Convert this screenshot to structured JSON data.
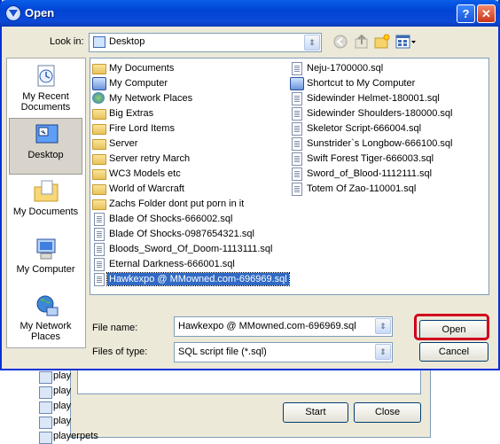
{
  "dialog": {
    "title": "Open",
    "help_label": "?",
    "close_label": "✕",
    "look_in_label": "Look in:",
    "look_in_value": "Desktop"
  },
  "places": [
    {
      "label": "My Recent Documents",
      "name": "place-my-recent-documents",
      "selected": false
    },
    {
      "label": "Desktop",
      "name": "place-desktop",
      "selected": true
    },
    {
      "label": "My Documents",
      "name": "place-my-documents",
      "selected": false
    },
    {
      "label": "My Computer",
      "name": "place-my-computer",
      "selected": false
    },
    {
      "label": "My Network Places",
      "name": "place-my-network-places",
      "selected": false
    }
  ],
  "files_col1": [
    {
      "name": "My Documents",
      "icon": "my-documents-icon"
    },
    {
      "name": "My Computer",
      "icon": "my-computer-icon"
    },
    {
      "name": "My Network Places",
      "icon": "network-places-icon"
    },
    {
      "name": "Big Extras",
      "icon": "folder-icon"
    },
    {
      "name": "Fire Lord Items",
      "icon": "folder-icon"
    },
    {
      "name": "Server",
      "icon": "folder-icon"
    },
    {
      "name": "Server retry March",
      "icon": "folder-icon"
    },
    {
      "name": "WC3 Models etc",
      "icon": "folder-icon"
    },
    {
      "name": "World of Warcraft",
      "icon": "folder-icon"
    },
    {
      "name": "Zachs Folder dont put porn in it",
      "icon": "folder-icon"
    },
    {
      "name": "Blade Of Shocks-666002.sql",
      "icon": "sql-file-icon"
    },
    {
      "name": "Blade Of Shocks-0987654321.sql",
      "icon": "sql-file-icon"
    },
    {
      "name": "Bloods_Sword_Of_Doom-1113111.sql",
      "icon": "sql-file-icon"
    },
    {
      "name": "Eternal Darkness-666001.sql",
      "icon": "sql-file-icon"
    },
    {
      "name": "Hawkexpo @ MMowned.com-696969.sql",
      "icon": "sql-file-icon",
      "selected": true
    }
  ],
  "files_col2": [
    {
      "name": "Neju-1700000.sql",
      "icon": "sql-file-icon"
    },
    {
      "name": "Shortcut to My Computer",
      "icon": "shortcut-icon"
    },
    {
      "name": "Sidewinder Helmet-180001.sql",
      "icon": "sql-file-icon"
    },
    {
      "name": "Sidewinder Shoulders-180000.sql",
      "icon": "sql-file-icon"
    },
    {
      "name": "Skeletor Script-666004.sql",
      "icon": "sql-file-icon"
    },
    {
      "name": "Sunstrider`s Longbow-666100.sql",
      "icon": "sql-file-icon"
    },
    {
      "name": "Swift Forest Tiger-666003.sql",
      "icon": "sql-file-icon"
    },
    {
      "name": "Sword_of_Blood-1112111.sql",
      "icon": "sql-file-icon"
    },
    {
      "name": "Totem Of Zao-110001.sql",
      "icon": "sql-file-icon"
    }
  ],
  "bottom": {
    "file_name_label": "File name:",
    "file_name_value": "Hawkexpo @ MMowned.com-696969.sql",
    "file_type_label": "Files of type:",
    "file_type_value": "SQL script file (*.sql)",
    "open_label": "Open",
    "cancel_label": "Cancel"
  },
  "background_window": {
    "start_label": "Start",
    "close_label": "Close",
    "items": [
      "play",
      "play",
      "play",
      "play",
      "playerpets"
    ]
  },
  "colors": {
    "title_bar": "#0a5fe8",
    "selection": "#316ac5",
    "highlight_ring": "#d1001c",
    "dialog_bg": "#ece9d8"
  }
}
